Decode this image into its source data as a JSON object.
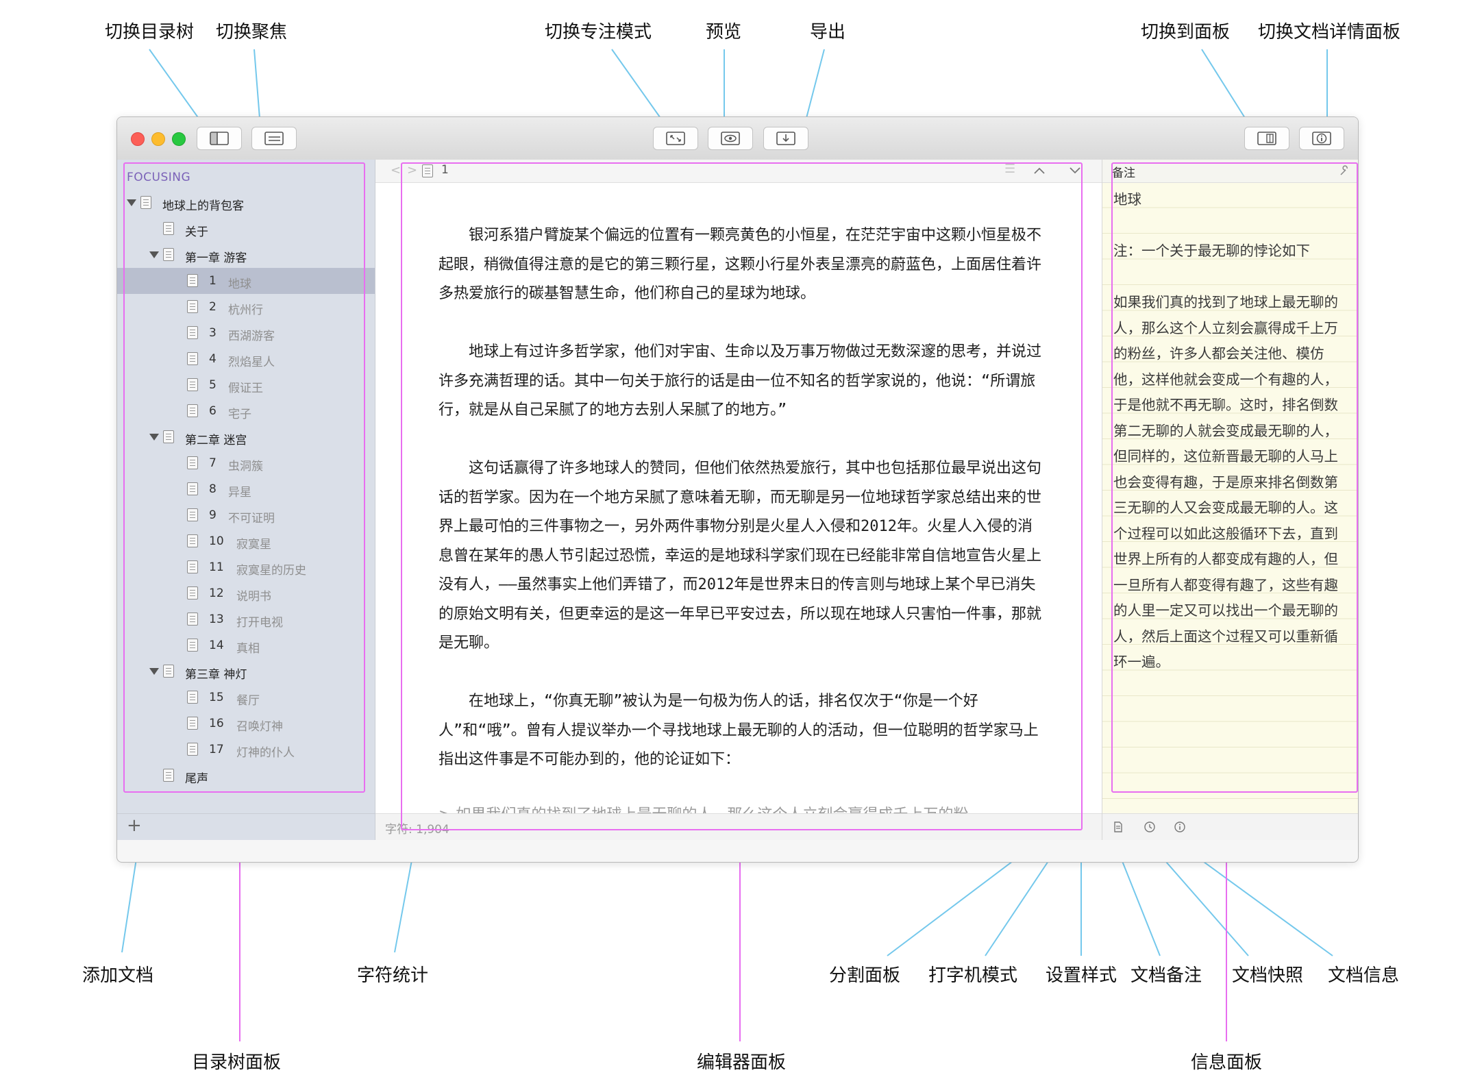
{
  "annotations": {
    "top": {
      "toggle_tree": "切换目录树",
      "toggle_focus": "切换聚焦",
      "toggle_zen": "切换专注模式",
      "preview": "预览",
      "export": "导出",
      "toggle_panel": "切换到面板",
      "toggle_doc_info": "切换文档详情面板"
    },
    "bottom": {
      "add_doc": "添加文档",
      "char_count": "字符统计",
      "split_panel": "分割面板",
      "typewriter": "打字机模式",
      "set_style": "设置样式",
      "doc_notes": "文档备注",
      "doc_snapshot": "文档快照",
      "doc_info": "文档信息"
    },
    "panels": {
      "tree_panel": "目录树面板",
      "editor_panel": "编辑器面板",
      "info_panel": "信息面板"
    }
  },
  "sidebar": {
    "focus_label": "FOCUSING",
    "root": "地球上的背包客",
    "about": "关于",
    "chapters": [
      {
        "title": "第一章 游客"
      },
      {
        "title": "第二章 迷宫"
      },
      {
        "title": "第三章 神灯"
      }
    ],
    "items": [
      {
        "num": "1",
        "name": "地球"
      },
      {
        "num": "2",
        "name": "杭州行"
      },
      {
        "num": "3",
        "name": "西湖游客"
      },
      {
        "num": "4",
        "name": "烈焰星人"
      },
      {
        "num": "5",
        "name": "假证王"
      },
      {
        "num": "6",
        "name": "宅子"
      },
      {
        "num": "7",
        "name": "虫洞簇"
      },
      {
        "num": "8",
        "name": "异星"
      },
      {
        "num": "9",
        "name": "不可证明"
      },
      {
        "num": "10",
        "name": "寂寞星"
      },
      {
        "num": "11",
        "name": "寂寞星的历史"
      },
      {
        "num": "12",
        "name": "说明书"
      },
      {
        "num": "13",
        "name": "打开电视"
      },
      {
        "num": "14",
        "name": "真相"
      },
      {
        "num": "15",
        "name": "餐厅"
      },
      {
        "num": "16",
        "name": "召唤灯神"
      },
      {
        "num": "17",
        "name": "灯神的仆人"
      }
    ],
    "epilogue": "尾声",
    "add_glyph": "+"
  },
  "editor": {
    "nav_back": "<",
    "nav_forward": ">",
    "doc_number": "1",
    "paragraphs": [
      "银河系猎户臂旋某个偏远的位置有一颗亮黄色的小恒星，在茫茫宇宙中这颗小恒星极不起眼，稍微值得注意的是它的第三颗行星，这颗小行星外表呈漂亮的蔚蓝色，上面居住着许多热爱旅行的碳基智慧生命，他们称自己的星球为地球。",
      "地球上有过许多哲学家，他们对宇宙、生命以及万事万物做过无数深邃的思考，并说过许多充满哲理的话。其中一句关于旅行的话是由一位不知名的哲学家说的，他说：“所谓旅行，就是从自己呆腻了的地方去别人呆腻了的地方。”",
      "这句话赢得了许多地球人的赞同，但他们依然热爱旅行，其中也包括那位最早说出这句话的哲学家。因为在一个地方呆腻了意味着无聊，而无聊是另一位地球哲学家总结出来的世界上最可怕的三件事物之一，另外两件事物分别是火星人入侵和2012年。火星人入侵的消息曾在某年的愚人节引起过恐慌，幸运的是地球科学家们现在已经能非常自信地宣告火星上没有人，——虽然事实上他们弄错了，而2012年是世界末日的传言则与地球上某个早已消失的原始文明有关，但更幸运的是这一年早已平安过去，所以现在地球人只害怕一件事，那就是无聊。",
      "在地球上，“你真无聊”被认为是一句极为伤人的话，排名仅次于“你是一个好人”和“哦”。曾有人提议举办一个寻找地球上最无聊的人的活动，但一位聪明的哲学家马上指出这件事是不可能办到的，他的论证如下："
    ],
    "quote": ">  如果我们真的找到了地球上最无聊的人，那么这个人立刻会赢得成千上万的粉",
    "char_count": "字符: 1,904"
  },
  "info": {
    "header": "备注",
    "title": "地球",
    "note_label": "注：一个关于最无聊的悖论如下",
    "lines": [
      "如果我们真的找到了地球上最无聊的",
      "人，那么这个人立刻会赢得成千上万",
      "的粉丝，许多人都会关注他、模仿",
      "他，这样他就会变成一个有趣的人，",
      "于是他就不再无聊。这时，排名倒数",
      "第二无聊的人就会变成最无聊的人，",
      "但同样的，这位新晋最无聊的人马上",
      "也会变得有趣，于是原来排名倒数第",
      "三无聊的人又会变成最无聊的人。这",
      "个过程可以如此这般循环下去，直到",
      "世界上所有的人都变成有趣的人，但",
      "一旦所有人都变得有趣了，这些有趣",
      "的人里一定又可以找出一个最无聊的",
      "人，然后上面这个过程又可以重新循",
      "环一遍。"
    ]
  },
  "colors": {
    "callout_line": "#74c8ec",
    "panel_outline": "#e86ef0",
    "focus_label": "#7b62b8"
  }
}
